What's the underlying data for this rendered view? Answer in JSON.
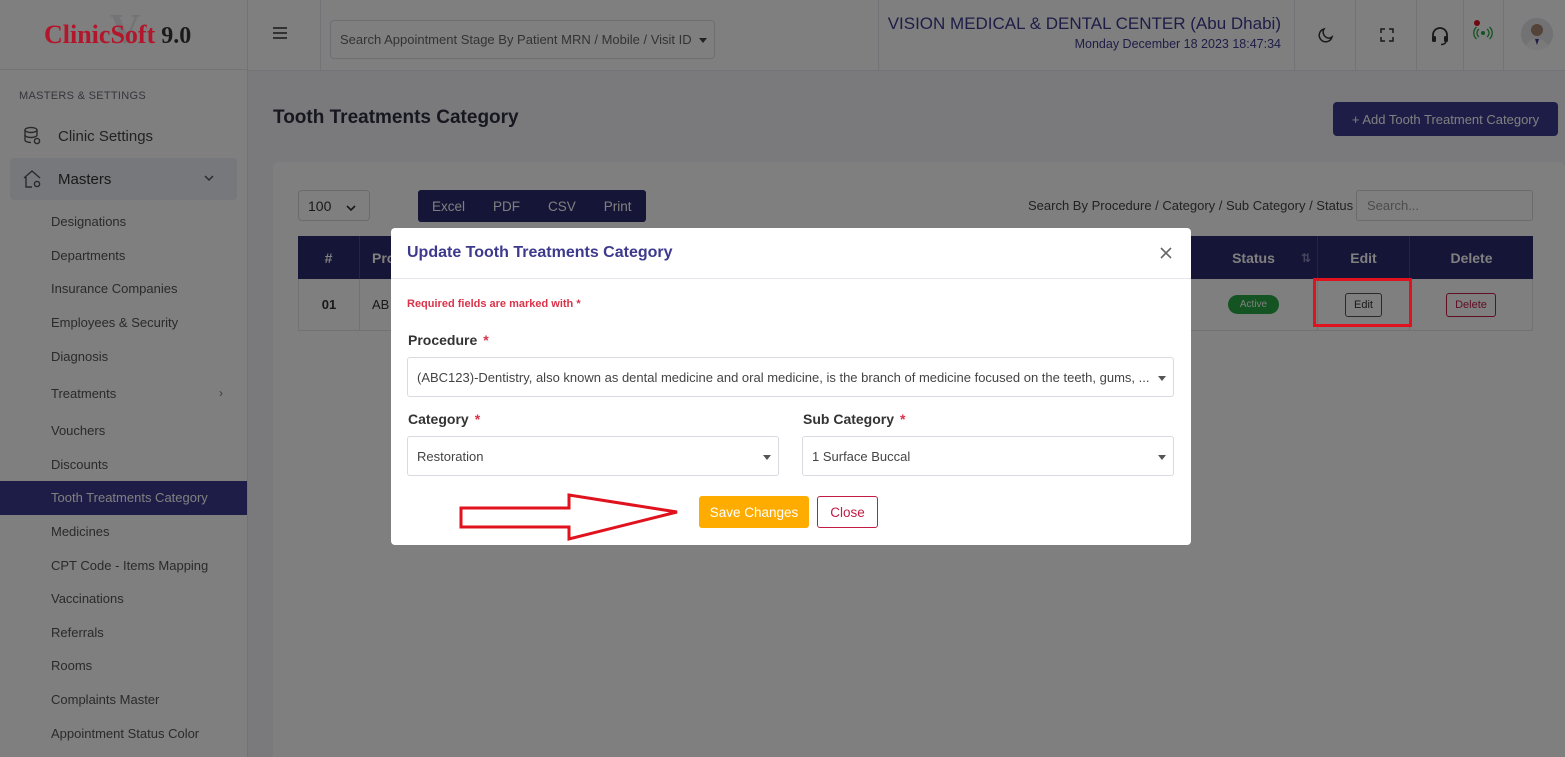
{
  "brand": {
    "name": "ClinicSoft",
    "version": "9.0",
    "watermark": "V"
  },
  "sidebar": {
    "section_title": "MASTERS & SETTINGS",
    "clinic_settings": "Clinic Settings",
    "masters": "Masters",
    "items": [
      {
        "label": "Designations"
      },
      {
        "label": "Departments"
      },
      {
        "label": "Insurance Companies"
      },
      {
        "label": "Employees & Security"
      },
      {
        "label": "Diagnosis"
      },
      {
        "label": "Treatments"
      },
      {
        "label": "Vouchers"
      },
      {
        "label": "Discounts"
      },
      {
        "label": "Tooth Treatments Category"
      },
      {
        "label": "Medicines"
      },
      {
        "label": "CPT Code - Items Mapping"
      },
      {
        "label": "Vaccinations"
      },
      {
        "label": "Referrals"
      },
      {
        "label": "Rooms"
      },
      {
        "label": "Complaints Master"
      },
      {
        "label": "Appointment Status Color"
      }
    ],
    "active_item": "Tooth Treatments Category"
  },
  "header": {
    "search_placeholder": "Search Appointment Stage By Patient MRN / Mobile / Visit ID",
    "clinic_name": "VISION MEDICAL & DENTAL CENTER (Abu Dhabi)",
    "datetime": "Monday December 18 2023 18:47:34",
    "icons": [
      "menu-icon",
      "moon-icon",
      "fullscreen-icon",
      "headset-icon",
      "broadcast-icon",
      "avatar"
    ]
  },
  "main": {
    "page_title": "Tooth Treatments Category",
    "add_button": "+ Add Tooth Treatment Category",
    "page_length": "100",
    "export_buttons": [
      "Excel",
      "PDF",
      "CSV",
      "Print"
    ],
    "search_label": "Search By Procedure / Category / Sub Category / Status",
    "search_placeholder": "Search...",
    "table": {
      "headers": [
        "#",
        "Pro",
        "Status",
        "Edit",
        "Delete"
      ],
      "rows": [
        {
          "num": "01",
          "procedure": "AB",
          "status": "Active",
          "edit": "Edit",
          "delete": "Delete"
        }
      ]
    }
  },
  "modal": {
    "title": "Update Tooth Treatments Category",
    "required_note": "Required fields are marked with *",
    "procedure_label": "Procedure",
    "procedure_value": "(ABC123)-Dentistry, also known as dental medicine and oral medicine, is the branch of medicine focused on the teeth, gums, ...",
    "category_label": "Category",
    "category_value": "Restoration",
    "subcategory_label": "Sub Category",
    "subcategory_value": "1 Surface Buccal",
    "required_mark": "*",
    "save_button": "Save Changes",
    "close_button": "Close"
  },
  "colors": {
    "primary": "#3d3a8e",
    "header_dark": "#2b2a6e",
    "save": "#ffac00",
    "danger": "#c21c45",
    "annotation": "#e0121e",
    "active_badge": "#28a745"
  }
}
